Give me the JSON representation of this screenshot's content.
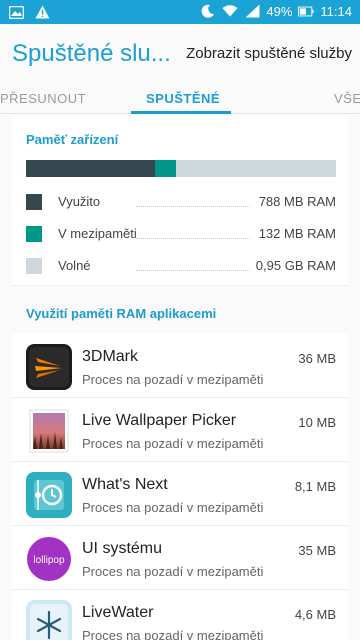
{
  "status_bar": {
    "left_icons": [
      "image-icon",
      "warning-icon"
    ],
    "right_icons": [
      "moon-icon",
      "wifi-icon",
      "signal-icon"
    ],
    "battery": "49%",
    "time": "11:14"
  },
  "appbar": {
    "title": "Spuštěné slu...",
    "action": "Zobrazit spuštěné služby"
  },
  "tabs": [
    {
      "label": "PŘESUNOUT",
      "selected": false
    },
    {
      "label": "SPUŠTĚNÉ",
      "selected": true
    },
    {
      "label": "VŠE",
      "selected": false
    }
  ],
  "memory": {
    "title": "Paměť zařízení",
    "segments": [
      {
        "name": "Využito",
        "value": "788 MB RAM",
        "fraction": 0.415,
        "color": "#37474f"
      },
      {
        "name": "V mezipaměti",
        "value": "132 MB RAM",
        "fraction": 0.069,
        "color": "#009688"
      },
      {
        "name": "Volné",
        "value": "0,95 GB RAM",
        "fraction": 0.516,
        "color": "#cfd8dc"
      }
    ]
  },
  "apps_section": {
    "title": "Využití paměti RAM aplikacemi"
  },
  "apps": [
    {
      "name": "3DMark",
      "status": "Proces na pozadí v mezipaměti",
      "size": "36 MB",
      "icon": "3dmark-icon"
    },
    {
      "name": "Live Wallpaper Picker",
      "status": "Proces na pozadí v mezipaměti",
      "size": "10 MB",
      "icon": "wallpaper-icon"
    },
    {
      "name": "What's Next",
      "status": "Proces na pozadí v mezipaměti",
      "size": "8,1 MB",
      "icon": "whats-next-icon"
    },
    {
      "name": "UI systému",
      "status": "Proces na pozadí v mezipaměti",
      "size": "35 MB",
      "icon": "lollipop-icon",
      "icon_text": "lollipop"
    },
    {
      "name": "LiveWater",
      "status": "Proces na pozadí v mezipaměti",
      "size": "4,6 MB",
      "icon": "snowflake-icon"
    }
  ]
}
